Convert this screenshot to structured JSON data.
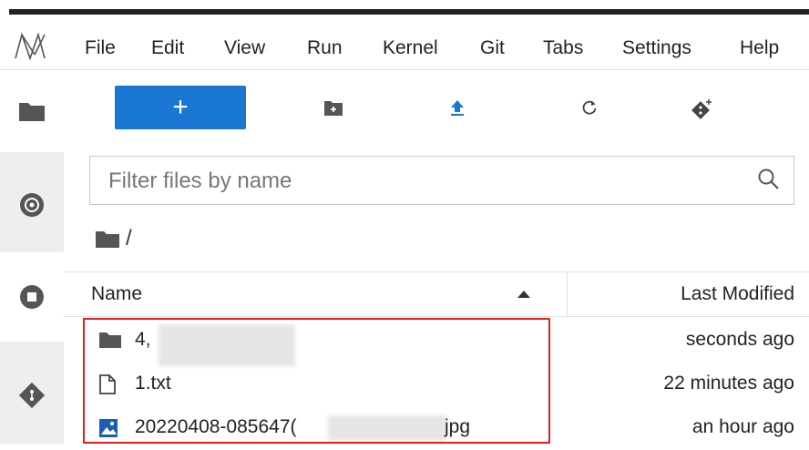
{
  "menu": {
    "items": [
      "File",
      "Edit",
      "View",
      "Run",
      "Kernel",
      "Git",
      "Tabs",
      "Settings",
      "Help"
    ]
  },
  "toolbar": {
    "new_label": "+",
    "icons": [
      "new-folder-icon",
      "upload-icon",
      "refresh-icon",
      "git-clone-icon"
    ]
  },
  "sidebar": {
    "tabs": [
      "folder-icon",
      "running-icon",
      "stop-icon",
      "git-icon"
    ]
  },
  "filter": {
    "placeholder": "Filter files by name"
  },
  "breadcrumb": {
    "path": "/"
  },
  "list": {
    "header_name": "Name",
    "header_modified": "Last Modified",
    "rows": [
      {
        "name": "4,",
        "modified": "seconds ago",
        "type": "folder"
      },
      {
        "name": "1.txt",
        "modified": "22 minutes ago",
        "type": "file"
      },
      {
        "name": "20220408-085647(",
        "name_suffix": "jpg",
        "modified": "an hour ago",
        "type": "image"
      }
    ]
  },
  "colors": {
    "accent": "#1976d2",
    "highlight": "#e0201e",
    "sidebar_bg": "#eeeeee"
  }
}
